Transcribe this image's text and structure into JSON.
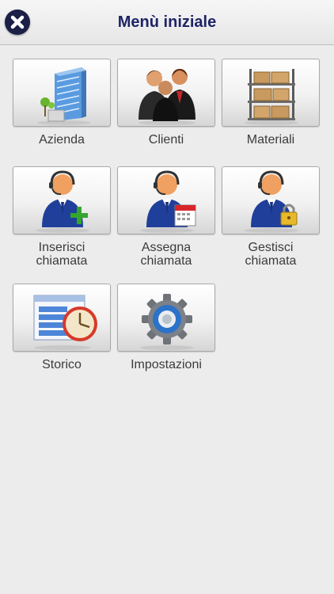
{
  "header": {
    "title": "Menù iniziale",
    "close_icon": "close-icon"
  },
  "menu": {
    "items": [
      {
        "label": "Azienda",
        "icon": "building-icon"
      },
      {
        "label": "Clienti",
        "icon": "people-icon"
      },
      {
        "label": "Materiali",
        "icon": "shelves-icon"
      },
      {
        "label": "Inserisci chiamata",
        "icon": "operator-add-icon"
      },
      {
        "label": "Assegna chiamata",
        "icon": "operator-calendar-icon"
      },
      {
        "label": "Gestisci chiamata",
        "icon": "operator-lock-icon"
      },
      {
        "label": "Storico",
        "icon": "history-clock-icon"
      },
      {
        "label": "Impostazioni",
        "icon": "settings-gear-icon"
      }
    ]
  },
  "colors": {
    "accent": "#1f2466",
    "background": "#ececec"
  }
}
